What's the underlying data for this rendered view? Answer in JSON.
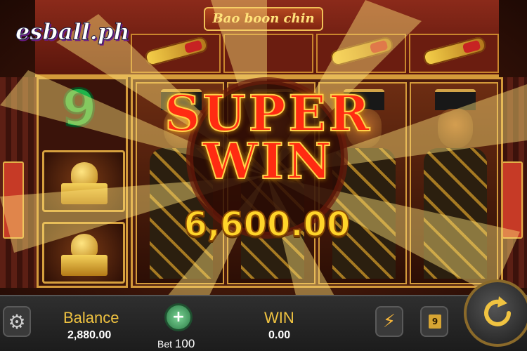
{
  "game": {
    "title": "Bao boon chin",
    "logo_text": "esball.ph"
  },
  "side_panel": {
    "multiplier": "9"
  },
  "win_banner": {
    "headline_line1": "SUPER",
    "headline_line2": "WIN",
    "amount": "6,600.00"
  },
  "bottom_bar": {
    "balance_label": "Balance",
    "balance_value": "2,880.00",
    "bet_label": "Bet",
    "bet_value": "100",
    "win_label": "WIN",
    "win_value": "0.00",
    "auto_count": "9"
  },
  "icons": {
    "settings": "gear-icon",
    "bet_chip": "plus-chip-icon",
    "turbo": "lightning-icon",
    "spin": "refresh-arrow-icon"
  },
  "colors": {
    "accent_gold": "#f0c341",
    "win_red": "#ff2b12",
    "multiplier_green": "#1fb34a",
    "frame_red": "#8b2a1a"
  }
}
